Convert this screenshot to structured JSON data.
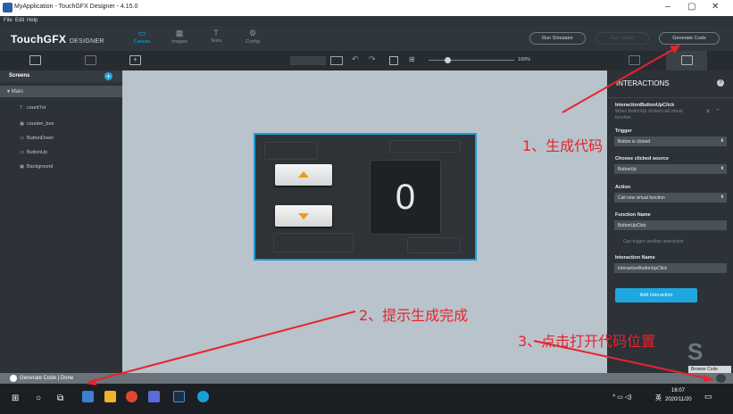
{
  "window": {
    "title": "MyApplication - TouchGFX Designer - 4.15.0",
    "minimize": "–",
    "maximize": "▢",
    "close": "✕"
  },
  "menu": [
    "File",
    "Edit",
    "Help"
  ],
  "toolbar": {
    "logo_main": "TouchGFX",
    "logo_sub": "DESIGNER",
    "tabs": [
      {
        "label": "Canvas",
        "icon": "▭"
      },
      {
        "label": "Images",
        "icon": "▦"
      },
      {
        "label": "Texts",
        "icon": "T"
      },
      {
        "label": "Config",
        "icon": "⚙"
      }
    ],
    "run_simulator": "Run Simulator",
    "run_target": "Run Target",
    "generate_code": "Generate Code"
  },
  "subbar": {
    "zoom": "100%"
  },
  "sidebar": {
    "header": "Screens",
    "screen": "Main",
    "items": [
      {
        "label": "countTxt",
        "icon": "T"
      },
      {
        "label": "counter_box",
        "icon": "▣"
      },
      {
        "label": "ButtonDown",
        "icon": "▭"
      },
      {
        "label": "ButtonUp",
        "icon": "▭"
      },
      {
        "label": "Background",
        "icon": "▣"
      }
    ]
  },
  "device": {
    "counter_value": "0"
  },
  "interactions": {
    "title": "INTERACTIONS",
    "help": "?",
    "item_name": "InteractionButtonUpClick",
    "item_desc": "When ButtonUp clicked call virtual function",
    "trigger_label": "Trigger",
    "trigger_value": "Button is clicked",
    "source_label": "Choose clicked source",
    "source_value": "ButtonUp",
    "action_label": "Action",
    "action_value": "Call new virtual function",
    "function_label": "Function Name",
    "function_value": "ButtonUpClick",
    "trigger_another": "Can trigger another interaction",
    "interaction_name_label": "Interaction Name",
    "interaction_name_value": "InteractionButtonUpClick",
    "add_button": "Add Interaction"
  },
  "status": {
    "text": "Generate Code  |  Done"
  },
  "browse_code": "Browse Code",
  "taskbar": {
    "time": "16:07",
    "date": "2020/11/20",
    "lang": "英"
  },
  "annotations": {
    "step1": "1、生成代码",
    "step2": "2、提示生成完成",
    "step3": "3、点击打开代码位置"
  },
  "colors": {
    "accent": "#1fa8e0",
    "annotation": "#e8232d",
    "panel": "#2c3237"
  }
}
